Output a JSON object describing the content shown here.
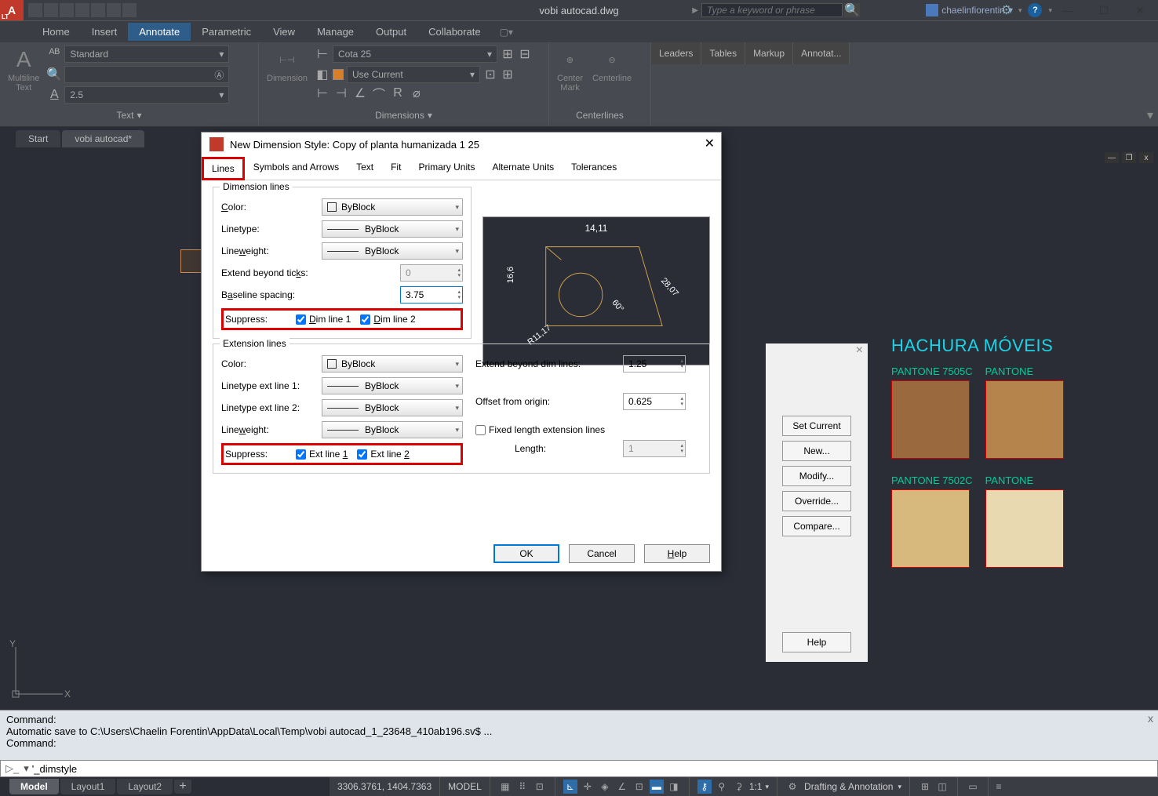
{
  "app": {
    "title": "vobi autocad.dwg",
    "search_placeholder": "Type a keyword or phrase",
    "user": "chaelinfiorentin"
  },
  "menutabs": [
    "Home",
    "Insert",
    "Annotate",
    "Parametric",
    "View",
    "Manage",
    "Output",
    "Collaborate"
  ],
  "menutab_active": "Annotate",
  "ribbon": {
    "text": {
      "big": "Multiline\nText",
      "style": "Standard",
      "height": "2.5",
      "panel": "Text"
    },
    "dim": {
      "big": "Dimension",
      "style": "Cota 25",
      "layer": "Use Current",
      "panel": "Dimensions"
    },
    "center": {
      "mark": "Center\nMark",
      "line": "Centerline",
      "panel": "Centerlines"
    },
    "mini": [
      "Leaders",
      "Tables",
      "Markup",
      "Annotat..."
    ]
  },
  "filetabs": {
    "start": "Start",
    "current": "vobi autocad*"
  },
  "hachura": {
    "title": "HACHURA MÓVEIS",
    "s1": {
      "label": "PANTONE 7505C",
      "color": "#9a6a3e"
    },
    "s2": {
      "label": "PANTONE",
      "color": "#b5844d"
    },
    "s3": {
      "label": "PANTONE 7502C",
      "color": "#d8b97d"
    },
    "s4": {
      "label": "PANTONE",
      "color": "#e9d9b0"
    }
  },
  "hatch_buttons": [
    "Set Current",
    "New...",
    "Modify...",
    "Override...",
    "Compare...",
    "Help"
  ],
  "dialog": {
    "title": "New Dimension Style: Copy of planta humanizada 1 25",
    "tabs": [
      "Lines",
      "Symbols and Arrows",
      "Text",
      "Fit",
      "Primary Units",
      "Alternate Units",
      "Tolerances"
    ],
    "active_tab": "Lines",
    "dim_group": "Dimension lines",
    "dim_color_label": "Color:",
    "dim_color": "ByBlock",
    "dim_ltype_label": "Linetype:",
    "dim_ltype": "ByBlock",
    "dim_lwt_label": "Lineweight:",
    "dim_lwt": "ByBlock",
    "extend_ticks_label": "Extend beyond ticks:",
    "extend_ticks": "0",
    "baseline_label": "Baseline spacing:",
    "baseline": "3.75",
    "suppress_label": "Suppress:",
    "dimline1": "Dim line 1",
    "dimline2": "Dim line 2",
    "ext_group": "Extension lines",
    "ext_color_label": "Color:",
    "ext_color": "ByBlock",
    "ext_lt1_label": "Linetype ext line 1:",
    "ext_lt1": "ByBlock",
    "ext_lt2_label": "Linetype ext line 2:",
    "ext_lt2": "ByBlock",
    "ext_lwt_label": "Lineweight:",
    "ext_lwt": "ByBlock",
    "ext_sup1": "Ext line 1",
    "ext_sup2": "Ext line 2",
    "ext_beyond_label": "Extend beyond dim lines:",
    "ext_beyond": "1.25",
    "offset_label": "Offset from origin:",
    "offset": "0.625",
    "fixed_label": "Fixed length extension lines",
    "length_label": "Length:",
    "length": "1",
    "preview": {
      "d1": "14,11",
      "d2": "16,6",
      "d3": "28,07",
      "d4": "60°",
      "d5": "R11,17"
    },
    "ok": "OK",
    "cancel": "Cancel",
    "help": "Help"
  },
  "cmd": {
    "l1": "Command:",
    "l2": "Automatic save to C:\\Users\\Chaelin Forentin\\AppData\\Local\\Temp\\vobi autocad_1_23648_410ab196.sv$ ...",
    "l3": "Command:",
    "input": "'_dimstyle"
  },
  "layouts": [
    "Model",
    "Layout1",
    "Layout2"
  ],
  "status": {
    "coords": "3306.3761, 1404.7363",
    "model": "MODEL",
    "scale": "1:1",
    "workspace": "Drafting & Annotation"
  }
}
